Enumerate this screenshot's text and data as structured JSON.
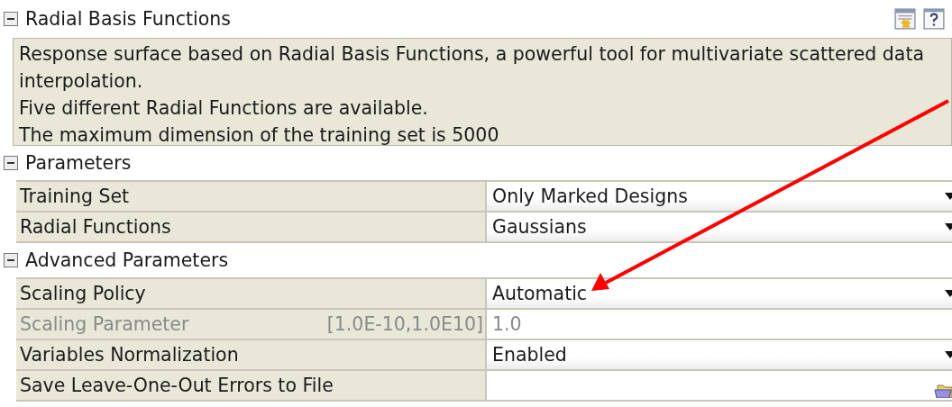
{
  "panel": {
    "title": "Radial Basis Functions",
    "expanded": true
  },
  "description": [
    "Response surface based on Radial Basis Functions, a powerful tool for multivariate scattered data interpolation.",
    "Five different Radial Functions are available.",
    "The maximum dimension of the training set is 5000"
  ],
  "sections": [
    {
      "title": "Parameters",
      "expanded": true,
      "rows": [
        {
          "label": "Training Set",
          "kind": "dropdown",
          "value": "Only Marked Designs",
          "disabled": false
        },
        {
          "label": "Radial Functions",
          "kind": "dropdown",
          "value": "Gaussians",
          "disabled": false
        }
      ]
    },
    {
      "title": "Advanced Parameters",
      "expanded": true,
      "rows": [
        {
          "label": "Scaling Policy",
          "kind": "dropdown",
          "value": "Automatic",
          "disabled": false
        },
        {
          "label": "Scaling Parameter",
          "kind": "number",
          "range": "[1.0E-10,1.0E10]",
          "value": "1.0",
          "disabled": true
        },
        {
          "label": "Variables Normalization",
          "kind": "dropdown",
          "value": "Enabled",
          "disabled": false
        },
        {
          "label": "Save Leave-One-Out Errors to File",
          "kind": "file",
          "disabled": false
        }
      ]
    }
  ]
}
